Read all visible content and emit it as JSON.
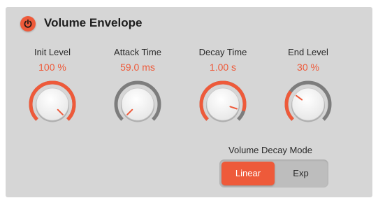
{
  "plugin": {
    "title": "Volume Envelope",
    "power_on": true
  },
  "colors": {
    "accent": "#ee5a3a",
    "panel": "#d6d6d6",
    "track": "#7d7d7d",
    "knob_face": "#f7f7f7"
  },
  "knobs": [
    {
      "label": "Init Level",
      "value": "100 %",
      "fraction": 1.0
    },
    {
      "label": "Attack Time",
      "value": "59.0 ms",
      "fraction": 0.0
    },
    {
      "label": "Decay Time",
      "value": "1.00 s",
      "fraction": 0.9
    },
    {
      "label": "End Level",
      "value": "30 %",
      "fraction": 0.3
    }
  ],
  "decay_mode": {
    "label": "Volume Decay Mode",
    "options": [
      "Linear",
      "Exp"
    ],
    "selected": "Linear"
  }
}
